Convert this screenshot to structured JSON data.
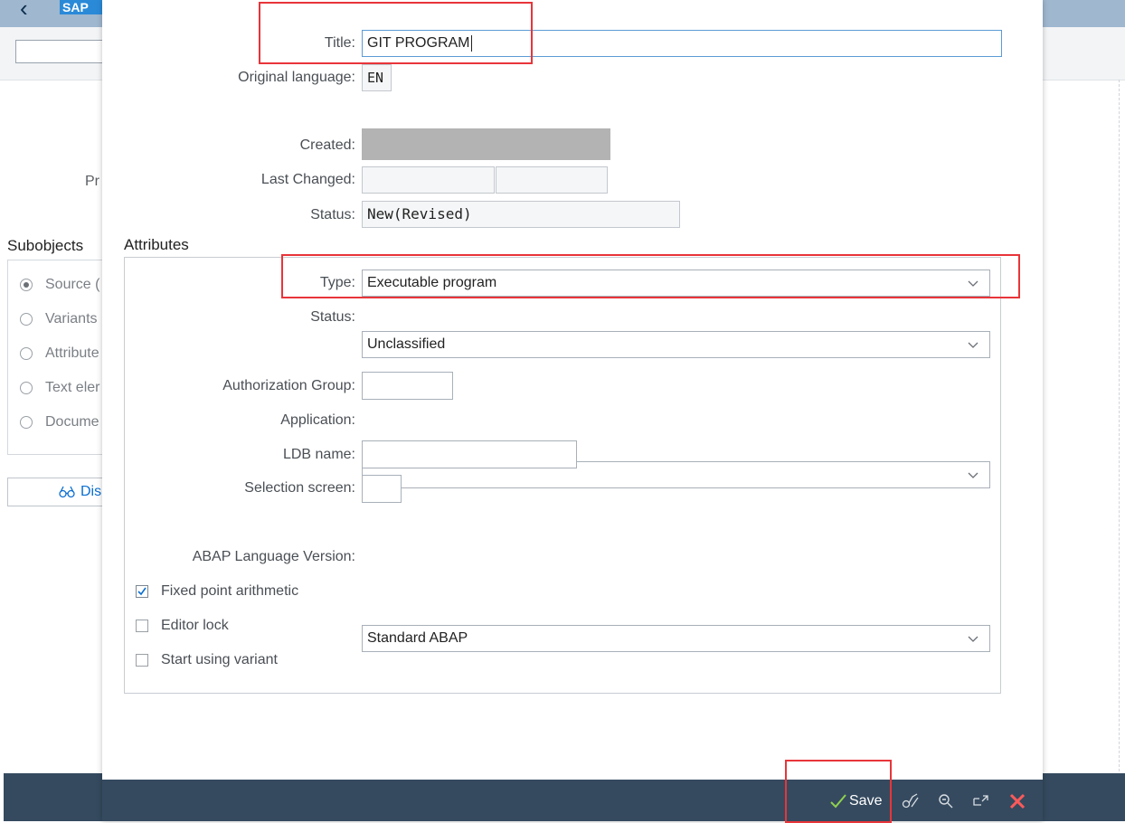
{
  "background": {
    "logo_text": "SAP",
    "back_glyph": "‹",
    "prog_label_fragment": "Pr",
    "subobjects_title": "Subobjects",
    "subobjects": [
      {
        "label": "Source (",
        "selected": true
      },
      {
        "label": "Variants",
        "selected": false
      },
      {
        "label": "Attribute",
        "selected": false
      },
      {
        "label": "Text eler",
        "selected": false
      },
      {
        "label": "Docume",
        "selected": false
      }
    ],
    "display_button_label": "Dis"
  },
  "dialog": {
    "title_label": "Title:",
    "title_value": "GIT PROGRAM",
    "original_language_label": "Original language:",
    "original_language_value": "EN",
    "created_label": "Created:",
    "last_changed_label": "Last Changed:",
    "status_label": "Status:",
    "status_value": "New(Revised)",
    "attributes_title": "Attributes",
    "attributes": {
      "type_label": "Type:",
      "type_value": "Executable program",
      "status_label": "Status:",
      "status_value": "Unclassified",
      "auth_group_label": "Authorization Group:",
      "auth_group_value": "",
      "application_label": "Application:",
      "application_value": "",
      "ldb_label": "LDB name:",
      "ldb_value": "",
      "selection_screen_label": "Selection screen:",
      "selection_screen_value": "",
      "abap_version_label": "ABAP Language Version:",
      "abap_version_value": "Standard ABAP",
      "checkboxes": [
        {
          "label": "Fixed point arithmetic",
          "checked": true
        },
        {
          "label": "Editor lock",
          "checked": false
        },
        {
          "label": "Start using variant",
          "checked": false
        }
      ]
    },
    "footer": {
      "save_label": "Save"
    }
  },
  "colors": {
    "highlight": "#e8353a",
    "footer_bg": "#354a5f",
    "header_bg": "#9fb7cf",
    "save_check": "#8fd14f",
    "cancel_x": "#ff5a5a"
  }
}
